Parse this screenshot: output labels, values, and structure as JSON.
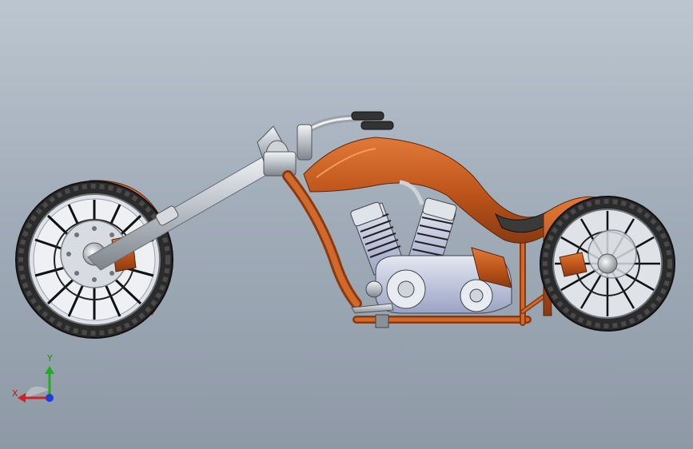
{
  "viewport": {
    "background_top": "#bcc6d0",
    "background_bottom": "#8e99a6"
  },
  "model": {
    "body_color": "#c0561c",
    "chrome_color": "#c9cdd2",
    "engine_color": "#aeb6d6",
    "tire_color": "#2a2a2a"
  },
  "triad": {
    "y_label": "Y",
    "x_label": "X",
    "y_color": "#1fae1f",
    "x_color": "#d42020",
    "z_color": "#1d3fd6"
  }
}
